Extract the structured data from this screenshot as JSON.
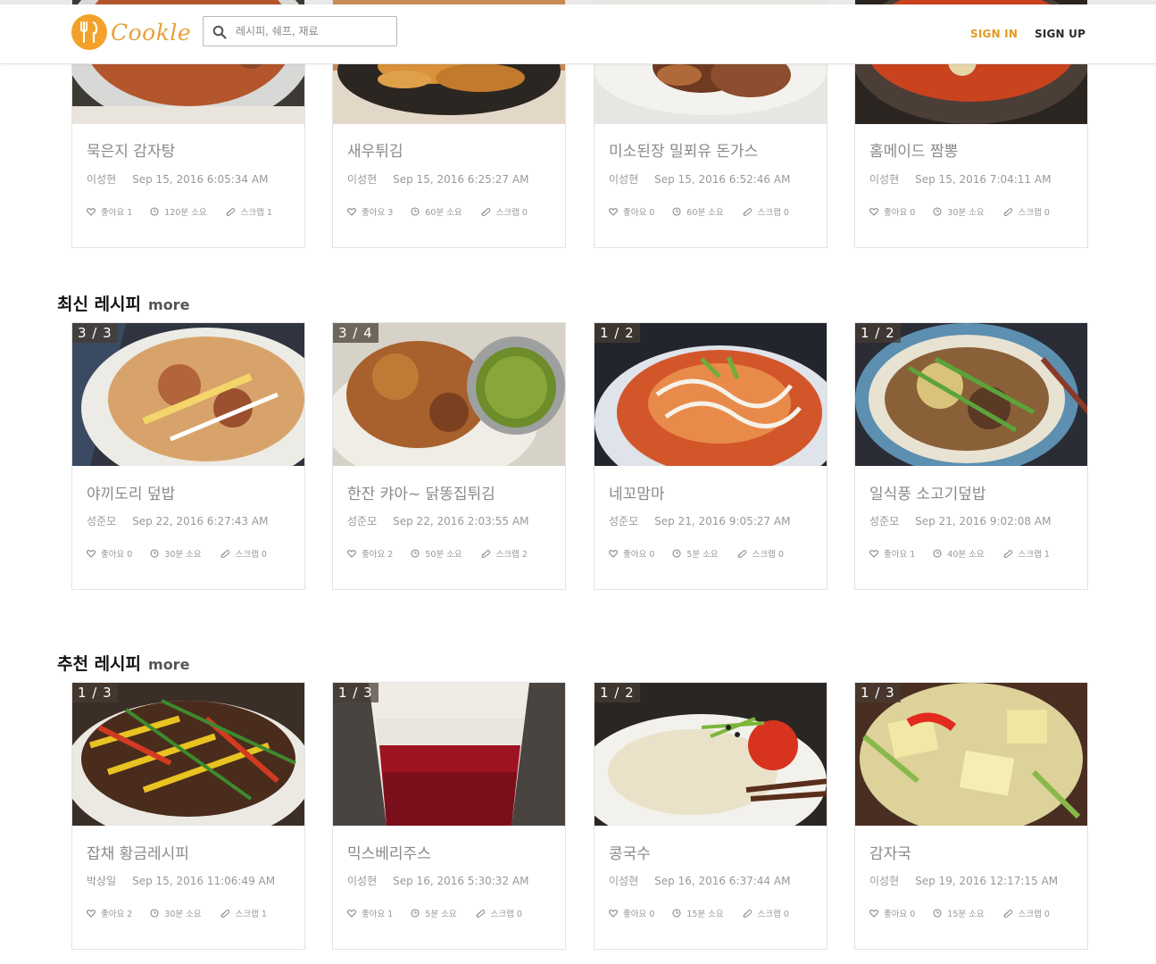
{
  "header": {
    "logo_text": "Cookle",
    "search_placeholder": "레시피, 쉐프, 재료",
    "sign_in": "SIGN IN",
    "sign_up": "SIGN UP",
    "accent_color": "#e39a1f"
  },
  "top_section": {
    "cards": [
      {
        "title": "묵은지 감자탕",
        "author": "이성현",
        "date": "Sep 15, 2016 6:05:34 AM",
        "likes": "좋아요 1",
        "time": "120분 소요",
        "scrap": "스크랩 1"
      },
      {
        "title": "새우튀김",
        "author": "이성현",
        "date": "Sep 15, 2016 6:25:27 AM",
        "likes": "좋아요 3",
        "time": "60분 소요",
        "scrap": "스크랩 0"
      },
      {
        "title": "미소된장 밀푀유 돈가스",
        "author": "이성현",
        "date": "Sep 15, 2016 6:52:46 AM",
        "likes": "좋아요 0",
        "time": "60분 소요",
        "scrap": "스크랩 0"
      },
      {
        "title": "홈메이드 짬뽕",
        "author": "이성현",
        "date": "Sep 15, 2016 7:04:11 AM",
        "likes": "좋아요 0",
        "time": "30분 소요",
        "scrap": "스크랩 0"
      }
    ]
  },
  "latest": {
    "title": "최신 레시피",
    "more": "more",
    "cards": [
      {
        "badge": "3 / 3",
        "title": "야끼도리 덮밥",
        "author": "성준모",
        "date": "Sep 22, 2016 6:27:43 AM",
        "likes": "좋아요 0",
        "time": "30분 소요",
        "scrap": "스크랩 0"
      },
      {
        "badge": "3 / 4",
        "title": "한잔 캬아~ 닭똥집튀김",
        "author": "성준모",
        "date": "Sep 22, 2016 2:03:55 AM",
        "likes": "좋아요 2",
        "time": "50분 소요",
        "scrap": "스크랩 2"
      },
      {
        "badge": "1 / 2",
        "title": "네꼬맘마",
        "author": "성준모",
        "date": "Sep 21, 2016 9:05:27 AM",
        "likes": "좋아요 0",
        "time": "5분 소요",
        "scrap": "스크랩 0"
      },
      {
        "badge": "1 / 2",
        "title": "일식풍 소고기덮밥",
        "author": "성준모",
        "date": "Sep 21, 2016 9:02:08 AM",
        "likes": "좋아요 1",
        "time": "40분 소요",
        "scrap": "스크랩 1"
      }
    ]
  },
  "recommended": {
    "title": "추천 레시피",
    "more": "more",
    "cards": [
      {
        "badge": "1 / 3",
        "title": "잡채 황금레시피",
        "author": "박상일",
        "date": "Sep 15, 2016 11:06:49 AM",
        "likes": "좋아요 2",
        "time": "30분 소요",
        "scrap": "스크랩 1"
      },
      {
        "badge": "1 / 3",
        "title": "믹스베리주스",
        "author": "이성현",
        "date": "Sep 16, 2016 5:30:32 AM",
        "likes": "좋아요 1",
        "time": "5분 소요",
        "scrap": "스크랩 0"
      },
      {
        "badge": "1 / 2",
        "title": "콩국수",
        "author": "이성현",
        "date": "Sep 16, 2016 6:37:44 AM",
        "likes": "좋아요 0",
        "time": "15분 소요",
        "scrap": "스크랩 0"
      },
      {
        "badge": "1 / 3",
        "title": "감자국",
        "author": "이성현",
        "date": "Sep 19, 2016 12:17:15 AM",
        "likes": "좋아요 0",
        "time": "15분 소요",
        "scrap": "스크랩 0"
      }
    ]
  }
}
